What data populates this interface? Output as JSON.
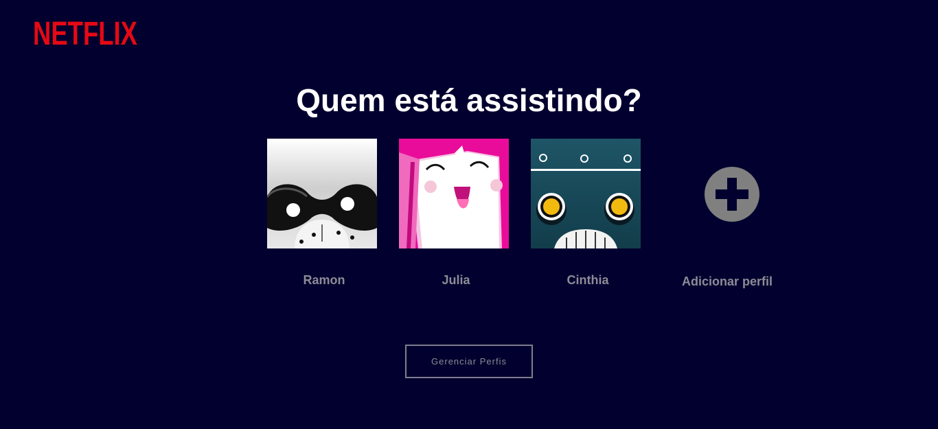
{
  "brand": {
    "logo_text": "NETFLIX",
    "logo_color": "#e50914"
  },
  "page": {
    "title": "Quem está assistindo?",
    "background": "#02002e"
  },
  "profiles": [
    {
      "name": "Ramon",
      "avatar": "raccoon-avatar"
    },
    {
      "name": "Julia",
      "avatar": "pink-smile-avatar"
    },
    {
      "name": "Cinthia",
      "avatar": "robot-avatar"
    }
  ],
  "add_profile": {
    "label": "Adicionar perfil",
    "icon": "plus-circle-icon"
  },
  "manage_button": {
    "label": "Gerenciar Perfis"
  }
}
